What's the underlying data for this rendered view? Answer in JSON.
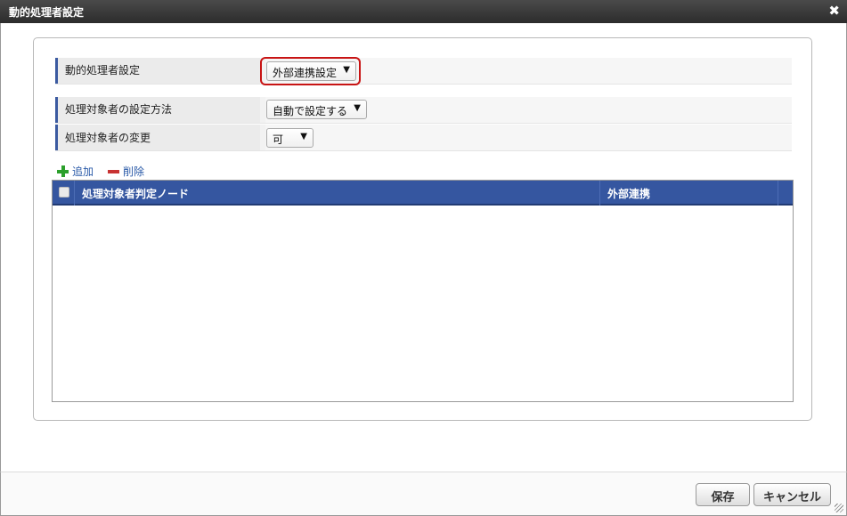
{
  "dialog": {
    "title": "動的処理者設定",
    "close_symbol": "✖"
  },
  "form": {
    "dynamic_setting": {
      "label": "動的処理者設定",
      "value": "外部連携設定"
    },
    "setting_method": {
      "label": "処理対象者の設定方法",
      "value": "自動で設定する"
    },
    "change_allowed": {
      "label": "処理対象者の変更",
      "value": "可"
    },
    "dropdown_arrow": "▼"
  },
  "toolbar": {
    "add_label": "追加",
    "delete_label": "削除"
  },
  "grid": {
    "columns": [
      "処理対象者判定ノード",
      "外部連携"
    ],
    "rows": []
  },
  "footer": {
    "save_label": "保存",
    "cancel_label": "キャンセル"
  },
  "colors": {
    "header_bg": "#3556a0",
    "highlight": "#c81414",
    "link": "#2a5aa8"
  },
  "icons": {
    "close": "close-icon",
    "add": "plus-icon",
    "delete": "minus-icon",
    "resize": "resize-grip-icon"
  }
}
